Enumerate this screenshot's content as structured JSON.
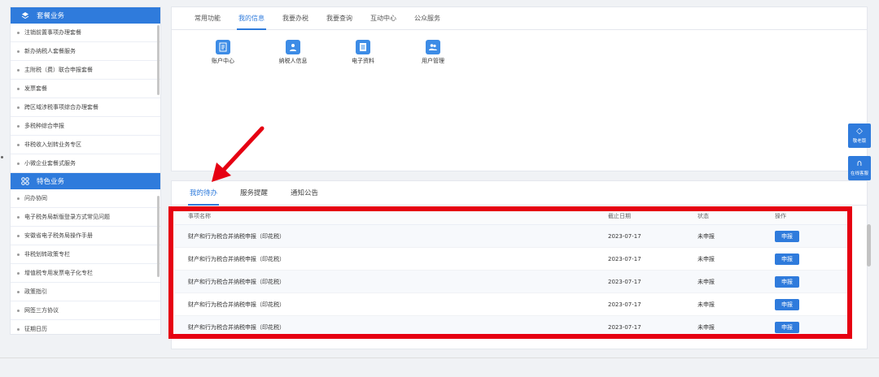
{
  "sidebar": {
    "section1": {
      "title": "套餐业务",
      "items": [
        "注销前置事项办理套餐",
        "新办纳税人套餐服务",
        "主附税（费）联合申报套餐",
        "发票套餐",
        "跨区域涉税事项综合办理套餐",
        "多税种综合申报",
        "非税收入划转业务专区",
        "小微企业套餐式服务"
      ]
    },
    "section2": {
      "title": "特色业务",
      "items": [
        "问办协同",
        "电子税务局新版登录方式常见问题",
        "安徽省电子税务局操作手册",
        "非税划转政策专栏",
        "增值税专用发票电子化专栏",
        "政策指引",
        "网签三方协议",
        "征期日历"
      ]
    }
  },
  "top_tabs": [
    "常用功能",
    "我的信息",
    "我要办税",
    "我要查询",
    "互动中心",
    "公众服务"
  ],
  "apps": [
    {
      "label": "账户中心",
      "icon": "account-icon"
    },
    {
      "label": "纳税人信息",
      "icon": "taxpayer-icon"
    },
    {
      "label": "电子资料",
      "icon": "document-icon"
    },
    {
      "label": "用户管理",
      "icon": "users-icon"
    }
  ],
  "bottom_tabs": [
    "我的待办",
    "服务提醒",
    "通知公告"
  ],
  "table": {
    "headers": {
      "name": "事项名称",
      "date": "截止日期",
      "status": "状态",
      "op": "操作"
    },
    "rows": [
      {
        "name": "财产和行为税合并纳税申报（印花税）",
        "date": "2023-07-17",
        "status": "未申报",
        "op": "申报"
      },
      {
        "name": "财产和行为税合并纳税申报（印花税）",
        "date": "2023-07-17",
        "status": "未申报",
        "op": "申报"
      },
      {
        "name": "财产和行为税合并纳税申报（印花税）",
        "date": "2023-07-17",
        "status": "未申报",
        "op": "申报"
      },
      {
        "name": "财产和行为税合并纳税申报（印花税）",
        "date": "2023-07-17",
        "status": "未申报",
        "op": "申报"
      },
      {
        "name": "财产和行为税合并纳税申报（印花税）",
        "date": "2023-07-17",
        "status": "未申报",
        "op": "申报"
      }
    ]
  },
  "float_buttons": [
    {
      "label": "敬老版",
      "icon": "tag-icon"
    },
    {
      "label": "在线客服",
      "icon": "headset-icon"
    }
  ],
  "colors": {
    "accent": "#2f7bdc",
    "highlight": "#e60012"
  }
}
